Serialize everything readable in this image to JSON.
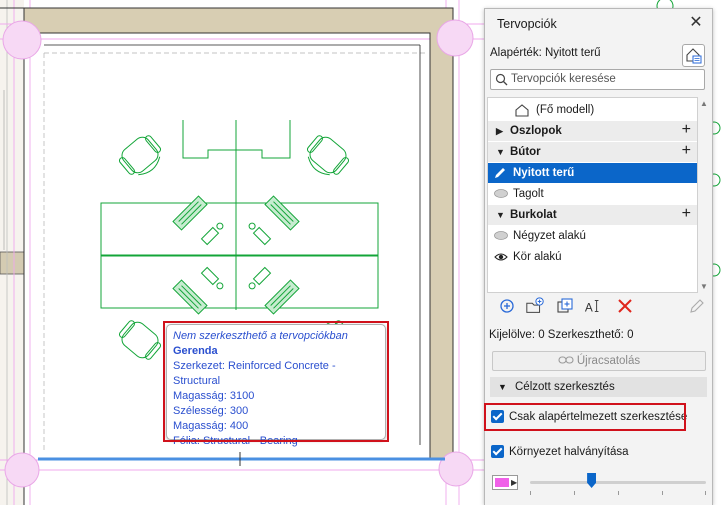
{
  "tooltip": {
    "header": "Nem szerkeszthető a tervopciókban",
    "name": "Gerenda",
    "lines": [
      "Szerkezet: Reinforced Concrete - Structural",
      "Magasság: 3100",
      "Szélesség: 300",
      "Magasság: 400",
      "Fólia: Structural - Bearing"
    ]
  },
  "panel": {
    "title": "Tervopciók",
    "default_label": "Alapérték: Nyitott terű",
    "search_placeholder": "Tervopciók keresése",
    "tree": [
      {
        "type": "model",
        "label": "(Fő modell)"
      },
      {
        "type": "group",
        "label": "Oszlopok"
      },
      {
        "type": "group",
        "label": "Bútor"
      },
      {
        "type": "option",
        "label": "Nyitott terű",
        "icon": "pencil-icon",
        "selected": true
      },
      {
        "type": "option",
        "label": "Tagolt",
        "icon": "eye-closed-icon"
      },
      {
        "type": "group",
        "label": "Burkolat"
      },
      {
        "type": "option",
        "label": "Négyzet alakú",
        "icon": "eye-closed-icon"
      },
      {
        "type": "option",
        "label": "Kör alakú",
        "icon": "eye-open-icon"
      }
    ],
    "counts": "Kijelölve: 0 Szerkeszthető: 0",
    "relink_label": "Újracsatolás",
    "section_label": "Célzott szerkesztés",
    "checkbox_default_edit": "Csak alapértelmezett szerkesztése",
    "checkbox_fade": "Környezet halványítása",
    "fade_value": 0.35
  },
  "colors": {
    "accent": "#0b66c9",
    "highlight": "#d0111b",
    "furniture": "#13a538",
    "tooltip_text": "#2a4fcf",
    "fade_swatch": "#f060e8"
  }
}
